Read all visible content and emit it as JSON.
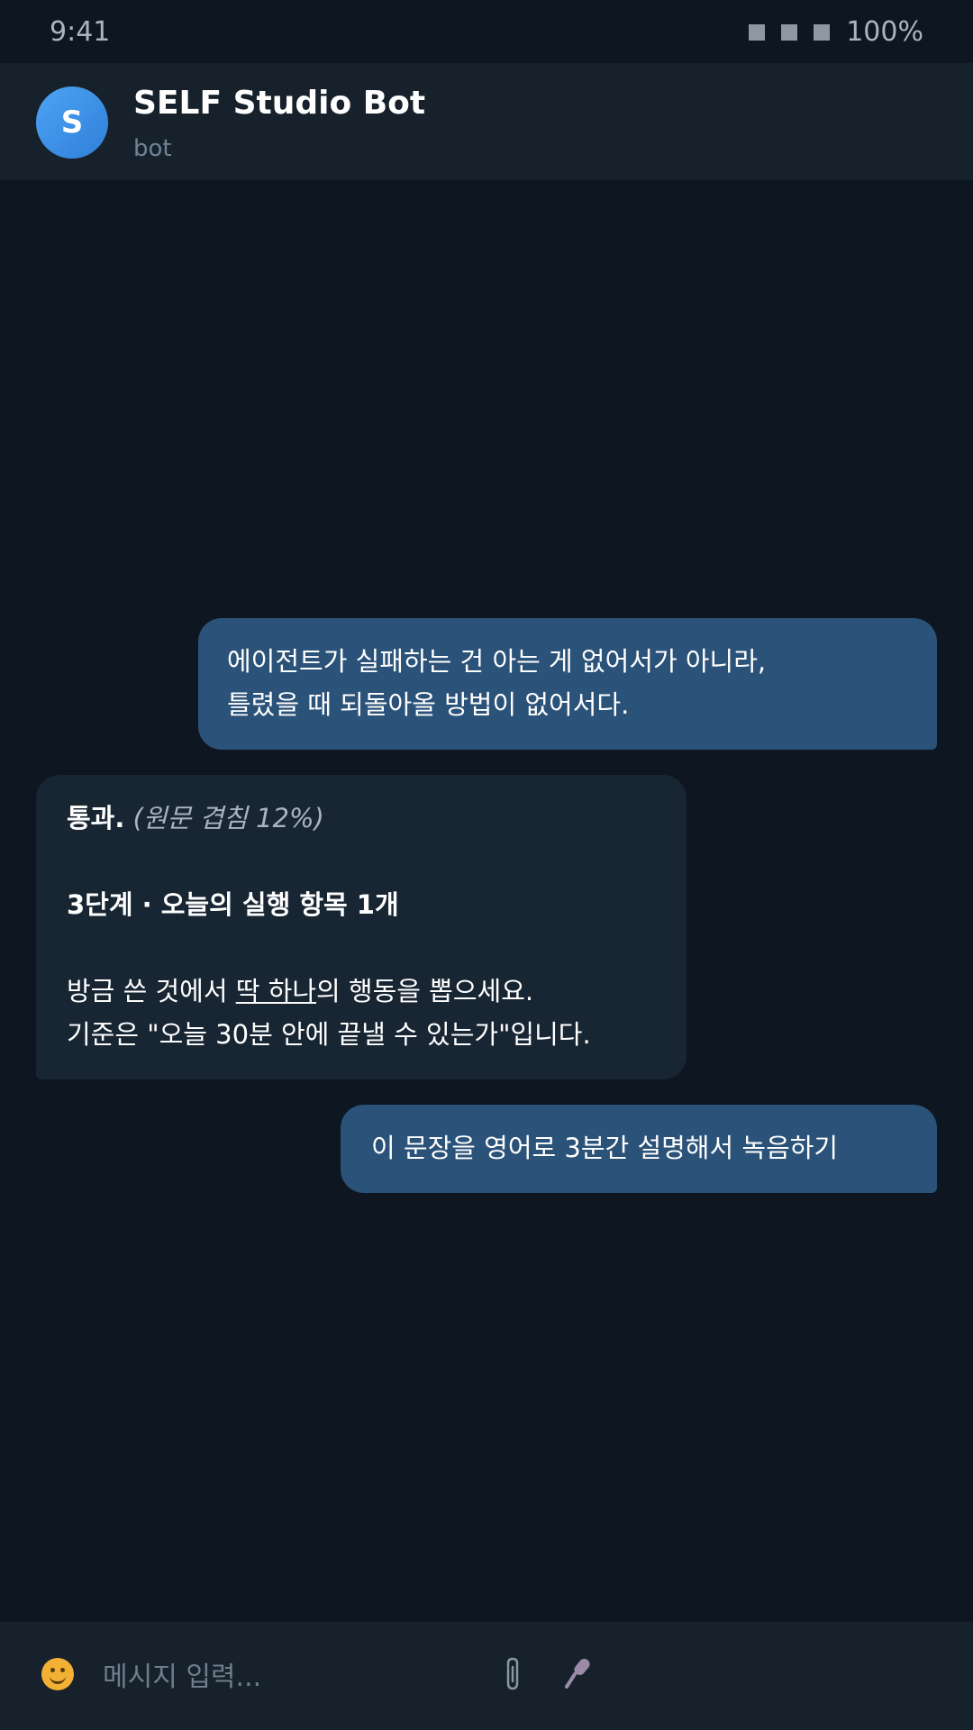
{
  "status_bar": {
    "time": "9:41",
    "battery": "100%",
    "icons": [
      "signal-icon",
      "wifi-icon",
      "battery-icon"
    ]
  },
  "header": {
    "avatar_letter": "S",
    "title": "SELF Studio Bot",
    "subtitle": "bot"
  },
  "messages": [
    {
      "direction": "outgoing",
      "lines": [
        "에이전트가 실패하는 건 아는 게 없어서가 아니라,",
        "틀렸을 때 되돌아올 방법이 없어서다."
      ]
    },
    {
      "direction": "incoming",
      "verdict": "통과.",
      "verdict_note": "(원문 겹침 12%)",
      "heading": "3단계 · 오늘의 실행 항목 1개",
      "body_line1_before": "방금 쓴 것에서 ",
      "body_line1_underlined": "딱 하나",
      "body_line1_after": "의 행동을 뽑으세요.",
      "body_line2": "기준은 \"오늘 30분 안에 끝낼 수 있는가\"입니다."
    },
    {
      "direction": "outgoing",
      "lines": [
        "이 문장을 영어로 3분간 설명해서 녹음하기"
      ]
    }
  ],
  "input_bar": {
    "placeholder": "메시지 입력...",
    "value": "",
    "icons": [
      "emoji-icon",
      "attach-icon",
      "mic-icon"
    ]
  },
  "colors": {
    "background": "#0e1621",
    "header": "#17212b",
    "outgoing_bubble": "#2b5278",
    "incoming_bubble": "#182533",
    "avatar": "#3a8ee6",
    "muted_text": "#6f8396"
  }
}
